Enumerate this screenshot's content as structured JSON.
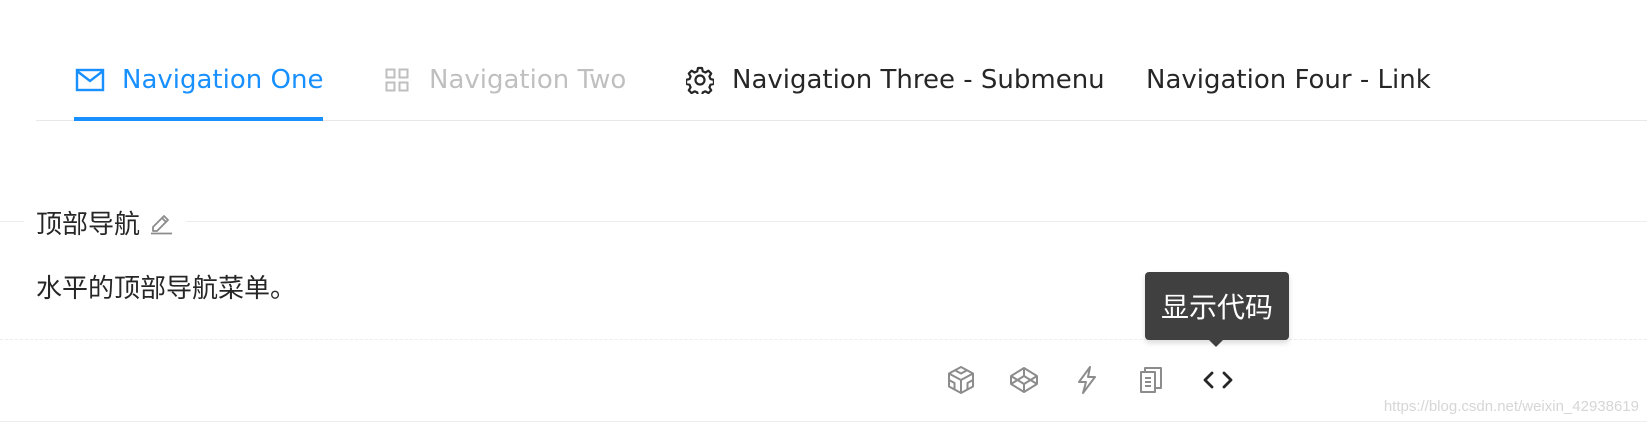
{
  "nav": {
    "items": [
      {
        "label": "Navigation One",
        "icon": "mail-icon",
        "state": "active"
      },
      {
        "label": "Navigation Two",
        "icon": "appstore-icon",
        "state": "disabled"
      },
      {
        "label": "Navigation Three - Submenu",
        "icon": "setting-icon",
        "state": "normal"
      },
      {
        "label": "Navigation Four - Link",
        "icon": "",
        "state": "normal"
      }
    ]
  },
  "demo": {
    "title": "顶部导航",
    "description": "水平的顶部导航菜单。",
    "actions": [
      {
        "icon": "codesandbox-icon"
      },
      {
        "icon": "codepen-icon"
      },
      {
        "icon": "thunderbolt-icon"
      },
      {
        "icon": "copy-icon"
      },
      {
        "icon": "code-icon"
      }
    ],
    "tooltip": "显示代码"
  },
  "watermark": "https://blog.csdn.net/weixin_42938619",
  "colors": {
    "accent": "#1890ff",
    "disabled_text": "#bfbfbf",
    "tooltip_bg": "#404040"
  }
}
